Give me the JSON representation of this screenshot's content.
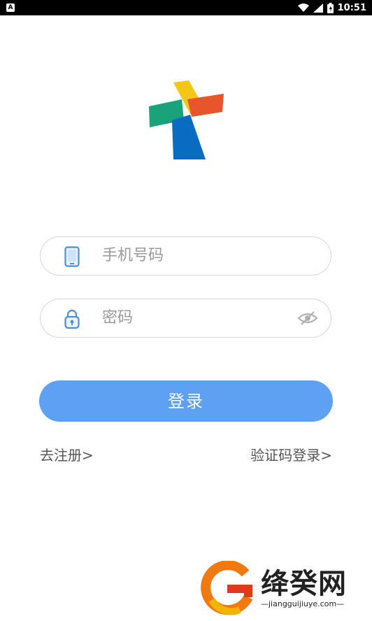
{
  "status_bar": {
    "time": "10:51",
    "notification_icon": "a-notification-icon",
    "icons": [
      "wifi-icon",
      "signal-icon",
      "battery-icon"
    ]
  },
  "logo": {
    "name": "app-logo"
  },
  "phone_field": {
    "placeholder": "手机号码",
    "icon": "phone-icon"
  },
  "password_field": {
    "placeholder": "密码",
    "icon": "lock-icon",
    "toggle_icon": "eye-hidden-icon"
  },
  "login_button": {
    "label": "登录"
  },
  "links": {
    "register": "去注册>",
    "sms_login": "验证码登录>"
  },
  "watermark": {
    "title": "绛癸网",
    "subtitle": "—jiangguijiuye.com—"
  },
  "colors": {
    "primary": "#5ea0f2",
    "field_border": "#d6d6d6",
    "icon_blue": "#4a90d9",
    "logo_yellow": "#f5c518",
    "logo_green": "#1aa37a",
    "logo_red": "#e8542b",
    "logo_blue": "#0a6cc0"
  }
}
